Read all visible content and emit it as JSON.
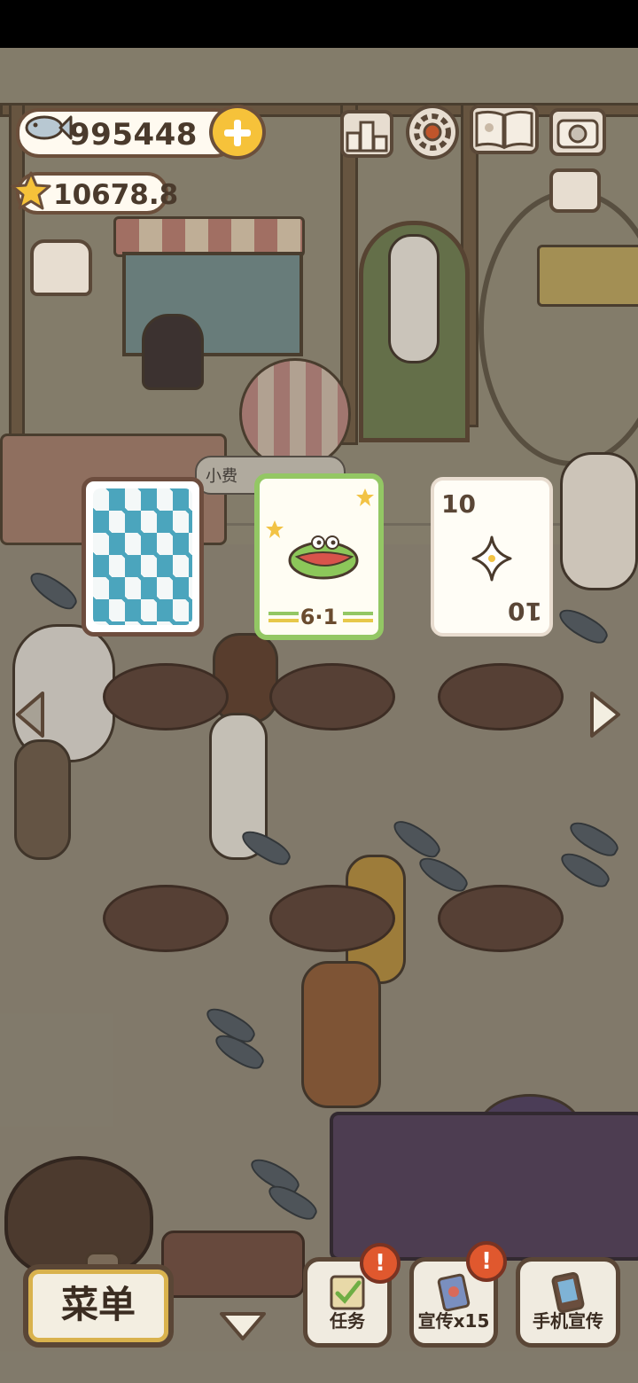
{
  "hud": {
    "fish_count": "995448",
    "star_count": "10678.8"
  },
  "scene": {
    "tip_bubble_text": "小费",
    "rank_icon_text": "2 1 3"
  },
  "cards": [
    {
      "type": "back",
      "icon": "diamond-pattern"
    },
    {
      "type": "crocodile",
      "score": "6·1",
      "border_color": "#93c764"
    },
    {
      "type": "number",
      "value": "10"
    }
  ],
  "bottom": {
    "menu_label": "菜单",
    "task_label": "任务",
    "promo_label": "宣传x15",
    "phone_promo_label": "手机宣传",
    "alert_symbol": "!"
  },
  "colors": {
    "accent_yellow": "#f6c23a",
    "card_green": "#93c764",
    "card_blue": "#4ba5bd",
    "alert_orange": "#e0582e"
  }
}
